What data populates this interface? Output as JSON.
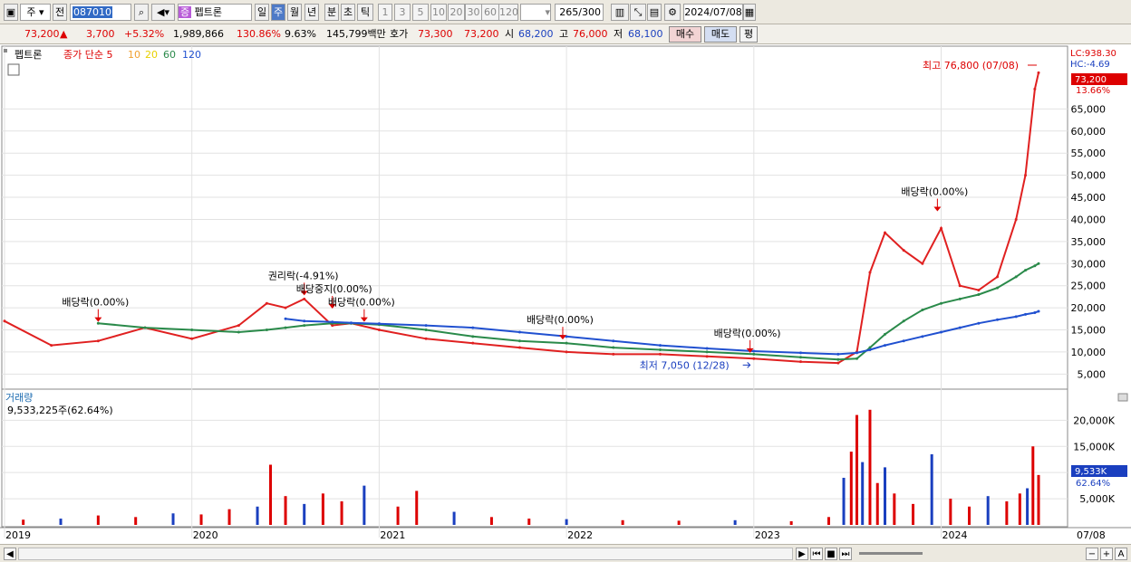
{
  "toolbar": {
    "market": "주",
    "prev": "전",
    "code": "087010",
    "stock_badge": "증",
    "stock_name": "펩트론",
    "periods": [
      "일",
      "주",
      "월",
      "년",
      "분",
      "초",
      "틱"
    ],
    "active_period": "주",
    "intervals": [
      "1",
      "3",
      "5",
      "10",
      "20",
      "30",
      "60",
      "120"
    ],
    "count": "265",
    "count_max": "/300",
    "date": "2024/07/08"
  },
  "quote": {
    "price": "73,200",
    "arrow": "▲",
    "change": "3,700",
    "change_pct": "+5.32%",
    "volume": "1,989,866",
    "vol_ratio": "130.86%",
    "turnover": "9.63%",
    "amount": "145,799백만",
    "bid_label": "호가",
    "bid1": "73,300",
    "bid2": "73,200",
    "open_label": "시",
    "open": "68,200",
    "high_label": "고",
    "high": "76,000",
    "low_label": "저",
    "low": "68,100",
    "buy": "매수",
    "sell": "매도",
    "flat": "평"
  },
  "colors": {
    "up": "#dd0000",
    "down": "#1a3fbf",
    "ma5": "#e02020",
    "ma10": "#f0a030",
    "ma20": "#f0e030",
    "ma60": "#2a8a4a",
    "ma120": "#2050d0",
    "grid": "#d0d0d0"
  },
  "chart_data": [
    {
      "type": "line",
      "title": "펩트론",
      "legend": [
        {
          "name": "종가 단순 5",
          "color": "#dd0000"
        },
        {
          "name": "10",
          "color": "#f0a030"
        },
        {
          "name": "20",
          "color": "#e8d000"
        },
        {
          "name": "60",
          "color": "#2a8a4a"
        },
        {
          "name": "120",
          "color": "#2050d0"
        }
      ],
      "x_tick_labels": [
        "2019",
        "2020",
        "2021",
        "2022",
        "2023",
        "2024",
        "07/08"
      ],
      "y_tick_labels": [
        "5,000",
        "10,000",
        "15,000",
        "20,000",
        "25,000",
        "30,000",
        "35,000",
        "40,000",
        "45,000",
        "50,000",
        "55,000",
        "60,000",
        "65,000"
      ],
      "ylim": [
        2000,
        79000
      ],
      "x": [
        2019.0,
        2019.25,
        2019.5,
        2019.75,
        2020.0,
        2020.25,
        2020.4,
        2020.5,
        2020.6,
        2020.75,
        2020.85,
        2021.0,
        2021.25,
        2021.5,
        2021.75,
        2022.0,
        2022.25,
        2022.5,
        2022.75,
        2023.0,
        2023.25,
        2023.45,
        2023.55,
        2023.62,
        2023.7,
        2023.8,
        2023.9,
        2024.0,
        2024.1,
        2024.2,
        2024.3,
        2024.4,
        2024.45,
        2024.5,
        2024.52
      ],
      "series": [
        {
          "name": "종가",
          "values": [
            17000,
            11500,
            12500,
            15500,
            13000,
            16000,
            21000,
            20000,
            22000,
            16000,
            16500,
            15000,
            13000,
            12000,
            11000,
            10000,
            9500,
            9500,
            9000,
            8500,
            7800,
            7500,
            10000,
            28000,
            37000,
            33000,
            30000,
            38000,
            25000,
            24000,
            27000,
            40000,
            50000,
            69500,
            73200
          ]
        },
        {
          "name": "60",
          "values": [
            null,
            null,
            16500,
            15500,
            15000,
            14500,
            15000,
            15500,
            16000,
            16500,
            16500,
            16200,
            15000,
            13500,
            12500,
            12000,
            11000,
            10500,
            10000,
            9500,
            8800,
            8300,
            8500,
            11000,
            14000,
            17000,
            19500,
            21000,
            22000,
            23000,
            24500,
            27000,
            28500,
            29500,
            30000
          ]
        },
        {
          "name": "120",
          "values": [
            null,
            null,
            null,
            null,
            null,
            null,
            null,
            17500,
            17000,
            16800,
            16600,
            16400,
            16000,
            15500,
            14500,
            13500,
            12500,
            11500,
            10800,
            10200,
            9800,
            9500,
            9800,
            10500,
            11500,
            12500,
            13500,
            14500,
            15500,
            16500,
            17300,
            18000,
            18500,
            18900,
            19200
          ]
        }
      ],
      "annotations": [
        {
          "text": "최고 76,800 (07/08)",
          "x": 2024.52,
          "y": 76800
        },
        {
          "text": "최저 7,050 (12/28)",
          "x": 2022.98,
          "y": 7050
        },
        {
          "text": "배당락(0.00%)",
          "x": 2019.5,
          "y": 16000
        },
        {
          "text": "권리락(-4.91%)",
          "x": 2020.6,
          "y": 22000
        },
        {
          "text": "배당중지(0.00%)",
          "x": 2020.75,
          "y": 19000
        },
        {
          "text": "배당락(0.00%)",
          "x": 2020.92,
          "y": 16000
        },
        {
          "text": "배당락(0.00%)",
          "x": 2021.98,
          "y": 12000
        },
        {
          "text": "배당락(0.00%)",
          "x": 2022.98,
          "y": 9000
        },
        {
          "text": "배당락(0.00%)",
          "x": 2023.98,
          "y": 41000
        }
      ],
      "right_labels": {
        "lc": "LC:938.30",
        "hc": "HC:-4.69",
        "price_tag": "73,200",
        "pct_tag": "13.66%"
      }
    },
    {
      "type": "bar",
      "title": "거래량",
      "subtitle": "9,533,225주(62.64%)",
      "y_tick_labels": [
        "5,000K",
        "10,000K",
        "15,000K",
        "20,000K"
      ],
      "ylim": [
        0,
        23000000
      ],
      "x": [
        2019.1,
        2019.3,
        2019.5,
        2019.7,
        2019.9,
        2020.05,
        2020.2,
        2020.35,
        2020.42,
        2020.5,
        2020.6,
        2020.7,
        2020.8,
        2020.92,
        2021.1,
        2021.2,
        2021.4,
        2021.6,
        2021.8,
        2022.0,
        2022.3,
        2022.6,
        2022.9,
        2023.2,
        2023.4,
        2023.48,
        2023.52,
        2023.55,
        2023.58,
        2023.62,
        2023.66,
        2023.7,
        2023.75,
        2023.85,
        2023.95,
        2024.05,
        2024.15,
        2024.25,
        2024.35,
        2024.42,
        2024.46,
        2024.49,
        2024.52
      ],
      "values": [
        1000000,
        1200000,
        1800000,
        1500000,
        2200000,
        2000000,
        3000000,
        3500000,
        11500000,
        5500000,
        4000000,
        6000000,
        4500000,
        7500000,
        3500000,
        6500000,
        2500000,
        1500000,
        1200000,
        1100000,
        900000,
        800000,
        900000,
        700000,
        1500000,
        9000000,
        14000000,
        21000000,
        12000000,
        22000000,
        8000000,
        11000000,
        6000000,
        4000000,
        13500000,
        5000000,
        3500000,
        5500000,
        4500000,
        6000000,
        7000000,
        15000000,
        9533225
      ],
      "right_labels": {
        "vol_tag": "9,533K",
        "vol_pct": "62.64%"
      }
    }
  ]
}
